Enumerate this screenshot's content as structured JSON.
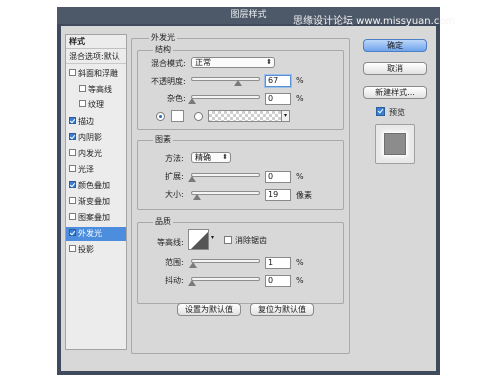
{
  "window": {
    "title": "图层样式"
  },
  "watermark": "思缘设计论坛 www.missyuan.com",
  "styles_panel": {
    "header": "样式",
    "blend_options": "混合选项:默认",
    "items": [
      {
        "label": "斜面和浮雕",
        "checked": false
      },
      {
        "label": "等高线",
        "checked": false
      },
      {
        "label": "纹理",
        "checked": false
      },
      {
        "label": "描边",
        "checked": true
      },
      {
        "label": "内阴影",
        "checked": true
      },
      {
        "label": "内发光",
        "checked": false
      },
      {
        "label": "光泽",
        "checked": false
      },
      {
        "label": "颜色叠加",
        "checked": true
      },
      {
        "label": "渐变叠加",
        "checked": false
      },
      {
        "label": "图案叠加",
        "checked": false
      },
      {
        "label": "外发光",
        "checked": true,
        "selected": true
      },
      {
        "label": "投影",
        "checked": false
      }
    ]
  },
  "outer_glow": {
    "title": "外发光",
    "structure": {
      "title": "结构",
      "blend_mode_label": "混合模式:",
      "blend_mode_value": "正常",
      "opacity_label": "不透明度:",
      "opacity_value": "67",
      "opacity_unit": "%",
      "noise_label": "杂色:",
      "noise_value": "0",
      "noise_unit": "%",
      "fill_mode": "color"
    },
    "elements": {
      "title": "图素",
      "technique_label": "方法:",
      "technique_value": "精确",
      "spread_label": "扩展:",
      "spread_value": "0",
      "spread_unit": "%",
      "size_label": "大小:",
      "size_value": "19",
      "size_unit": "像素"
    },
    "quality": {
      "title": "品质",
      "contour_label": "等高线:",
      "antialias_label": "消除锯齿",
      "antialias_checked": false,
      "range_label": "范围:",
      "range_value": "1",
      "range_unit": "%",
      "jitter_label": "抖动:",
      "jitter_value": "0",
      "jitter_unit": "%"
    },
    "buttons": {
      "set_default": "设置为默认值",
      "reset_default": "复位为默认值"
    }
  },
  "right_panel": {
    "ok": "确定",
    "cancel": "取消",
    "new_style": "新建样式...",
    "preview_label": "预览",
    "preview_checked": true
  },
  "colors": {
    "accent": "#4c8edd",
    "primary_button": "#6fa4ea",
    "frame": "#3f4a5c"
  },
  "icons": [
    "checkmark-icon",
    "dropdown-arrow-icon",
    "slider-thumb-icon",
    "contour-curve-icon"
  ]
}
